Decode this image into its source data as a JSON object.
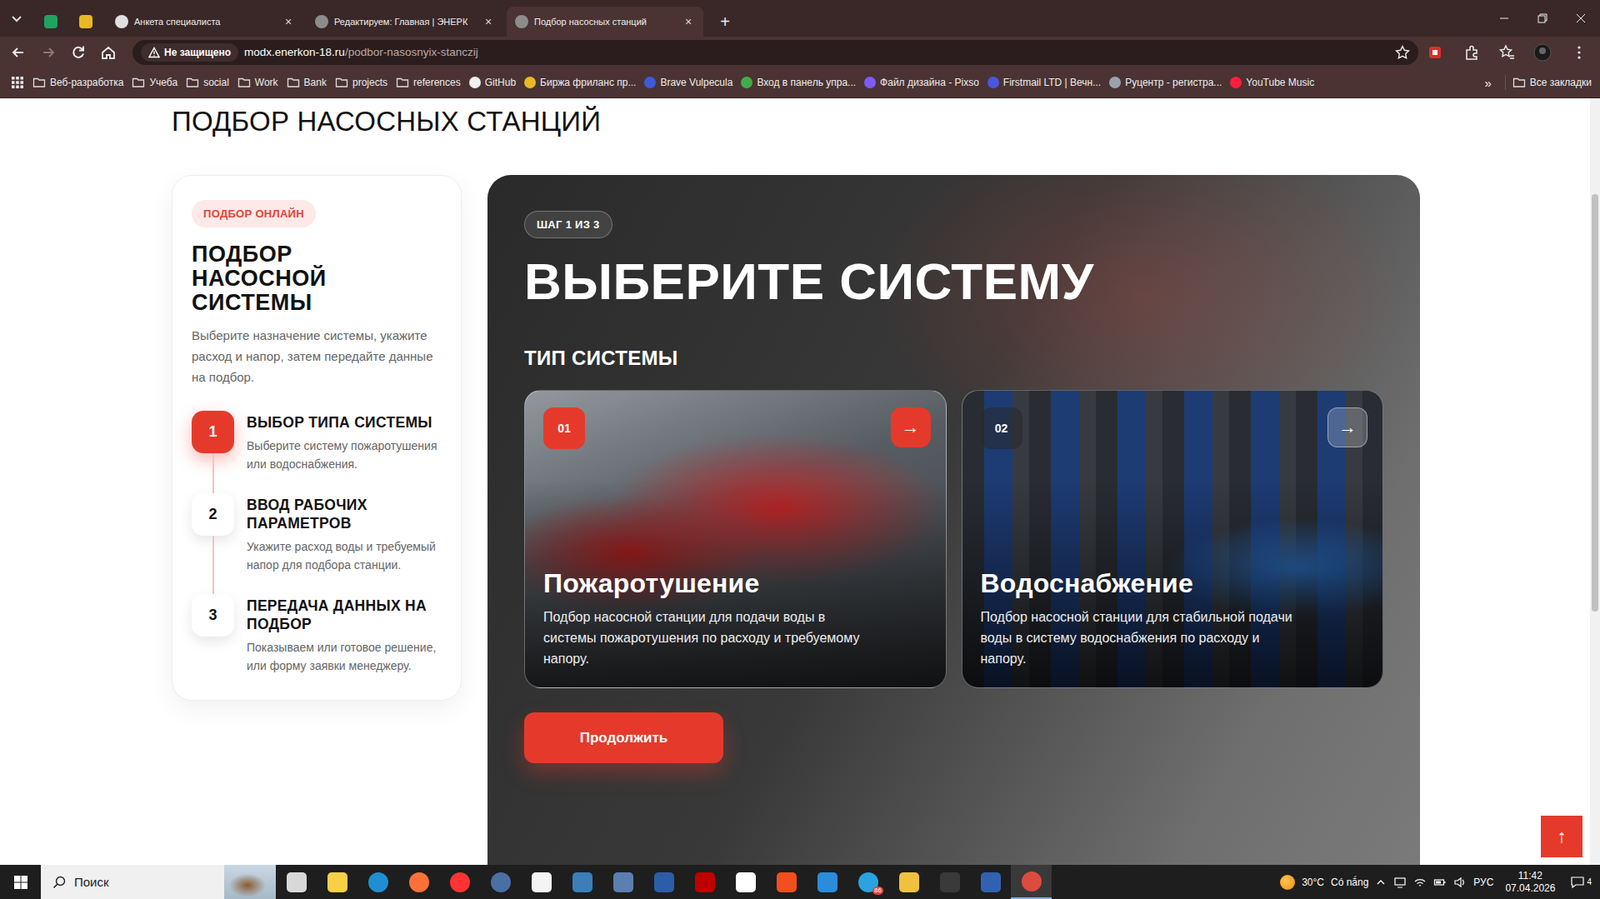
{
  "browser": {
    "tabs": [
      {
        "kind": "pinned",
        "selected": false,
        "color": "#1ea362"
      },
      {
        "kind": "pinned",
        "selected": false,
        "color": "#e8b923"
      },
      {
        "kind": "normal",
        "label": "Анкета специалиста",
        "close": "×",
        "selected": false,
        "color": "#e0e0e0"
      },
      {
        "kind": "normal",
        "label": "Редактируем: Главная | ЭНЕРК",
        "close": "×",
        "selected": false,
        "color": "#8c8c8c"
      },
      {
        "kind": "normal",
        "label": "Подбор насосных станций",
        "close": "×",
        "selected": true,
        "color": "#8c8c8c"
      }
    ],
    "new_tab": "+",
    "address": {
      "security": "Не защищено",
      "host": "modx.enerkon-18.ru",
      "path": "/podbor-nasosnyix-stanczij"
    },
    "bookmarks": {
      "items": [
        {
          "label": "Веб-разработка",
          "kind": "folder"
        },
        {
          "label": "Учеба",
          "kind": "folder"
        },
        {
          "label": "social",
          "kind": "folder"
        },
        {
          "label": "Work",
          "kind": "folder"
        },
        {
          "label": "Bank",
          "kind": "folder"
        },
        {
          "label": "projects",
          "kind": "folder"
        },
        {
          "label": "references",
          "kind": "folder"
        },
        {
          "label": "GitHub",
          "kind": "site",
          "color": "#f0f0f0"
        },
        {
          "label": "Биржа фриланс пр...",
          "kind": "site",
          "color": "#e8b923"
        },
        {
          "label": "Brave Vulpecula",
          "kind": "site",
          "color": "#3b5bdb"
        },
        {
          "label": "Вход в панель упра...",
          "kind": "site",
          "color": "#3fae49"
        },
        {
          "label": "Файл дизайна - Pixso",
          "kind": "site",
          "color": "#7b5cff"
        },
        {
          "label": "Firstmail LTD | Вечн...",
          "kind": "site",
          "color": "#4a55e0"
        },
        {
          "label": "Руцентр - регистра...",
          "kind": "site",
          "color": "#9aa3ad"
        },
        {
          "label": "YouTube Music",
          "kind": "site",
          "color": "#ff1e3c"
        }
      ],
      "more": "»",
      "all": "Все закладки"
    }
  },
  "page": {
    "title": "ПОДБОР НАСОСНЫХ СТАНЦИЙ",
    "sidebar": {
      "badge": "ПОДБОР ОНЛАЙН",
      "heading": "ПОДБОР НАСОСНОЙ СИСТЕМЫ",
      "description": "Выберите назначение системы, укажите расход и напор, затем передайте данные на подбор.",
      "steps": [
        {
          "number": "1",
          "title": "ВЫБОР ТИПА СИСТЕМЫ",
          "description": "Выберите систему пожаротушения или водоснабжения.",
          "selected": true
        },
        {
          "number": "2",
          "title": "ВВОД РАБОЧИХ ПАРАМЕТРОВ",
          "description": "Укажите расход воды и требуемый напор для подбора станции.",
          "selected": false
        },
        {
          "number": "3",
          "title": "ПЕРЕДАЧА ДАННЫХ НА ПОДБОР",
          "description": "Показываем или готовое решение, или форму заявки менеджеру.",
          "selected": false
        }
      ]
    },
    "wizard": {
      "step": "ШАГ 1 ИЗ 3",
      "heading": "ВЫБЕРИТЕ СИСТЕМУ",
      "subheading": "ТИП СИСТЕМЫ",
      "options": [
        {
          "number": "01",
          "title": "Пожаротушение",
          "description": "Подбор насосной станции для подачи воды в системы пожаротушения по расходу и требуемому напору.",
          "arrow": "→",
          "selected": true
        },
        {
          "number": "02",
          "title": "Водоснабжение",
          "description": "Подбор насосной станции для стабильной подачи воды в систему водоснабжения по расходу и напору.",
          "arrow": "→",
          "selected": false
        }
      ],
      "button": "Продолжить"
    },
    "scroll_top": "↑",
    "scrollbar": {
      "start": 0.125,
      "level": 0.545
    }
  },
  "taskbar": {
    "search": "Поиск",
    "apps": [
      {
        "selected": false,
        "color": "#d8d8d8"
      },
      {
        "selected": false,
        "color": "#f7d046"
      },
      {
        "selected": false,
        "color": "#1f8fd1"
      },
      {
        "selected": false,
        "color": "#ff7139"
      },
      {
        "selected": false,
        "color": "#ff3333"
      },
      {
        "selected": false,
        "color": "#4a6fa5"
      },
      {
        "selected": false,
        "color": "#f4f4f4"
      },
      {
        "selected": false,
        "color": "#3a7fb8"
      },
      {
        "selected": false,
        "color": "#5b7fb0"
      },
      {
        "selected": false,
        "color": "#2c5da8"
      },
      {
        "selected": false,
        "color": "#bf0000"
      },
      {
        "selected": false,
        "color": "#ffffff"
      },
      {
        "selected": false,
        "color": "#f24e1e"
      },
      {
        "selected": false,
        "color": "#2a8cdb"
      },
      {
        "selected": false,
        "color": "#2aa3e0",
        "badge": "86"
      },
      {
        "selected": false,
        "color": "#f0c040"
      },
      {
        "selected": false,
        "color": "#3a3a3a"
      },
      {
        "selected": false,
        "color": "#3161b3"
      },
      {
        "selected": true,
        "color": "#dd4b3e"
      }
    ],
    "weather": {
      "temp": "30°C",
      "text": "Có nắng"
    },
    "language": "РУС",
    "time": "11:42",
    "date": "07.04.2026",
    "notifications": "4"
  }
}
